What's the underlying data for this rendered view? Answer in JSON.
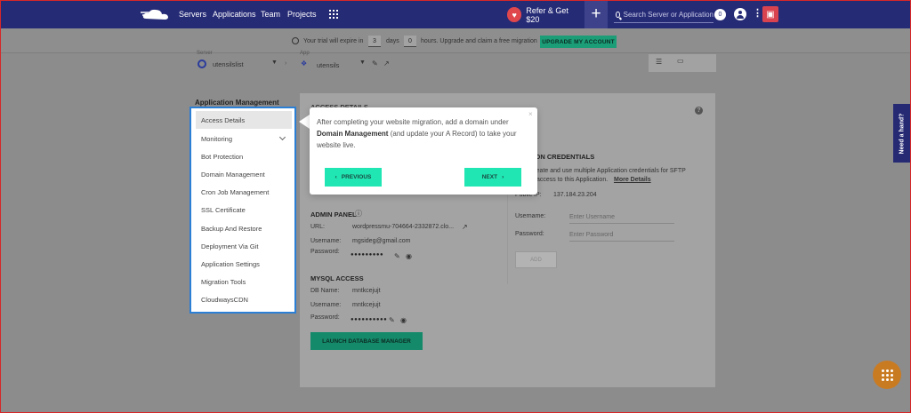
{
  "nav": {
    "links": [
      "Servers",
      "Applications",
      "Team",
      "Projects"
    ],
    "refer_label": "Refer & Get $20",
    "search_placeholder": "Search Server or Application",
    "notification_count": "0"
  },
  "trial": {
    "prefix": "Your trial will expire in",
    "days_value": "3",
    "days_label": "days",
    "hours_value": "0",
    "suffix": "hours. Upgrade and claim a free migration",
    "button": "UPGRADE MY ACCOUNT"
  },
  "context": {
    "server_label": "Server",
    "server_name": "utensilslist",
    "app_label": "App",
    "app_name": "utensils"
  },
  "sidebar": {
    "heading": "Application Management",
    "items": [
      {
        "label": "Access Details",
        "active": true
      },
      {
        "label": "Monitoring"
      },
      {
        "label": "Bot Protection"
      },
      {
        "label": "Domain Management"
      },
      {
        "label": "Cron Job Management"
      },
      {
        "label": "SSL Certificate"
      },
      {
        "label": "Backup And Restore"
      },
      {
        "label": "Deployment Via Git"
      },
      {
        "label": "Application Settings"
      },
      {
        "label": "Migration Tools"
      },
      {
        "label": "CloudwaysCDN"
      }
    ]
  },
  "card": {
    "title": "ACCESS DETAILS",
    "admin_panel": {
      "title": "ADMIN PANEL",
      "url_label": "URL:",
      "url_value": "wordpressmu-704664-2332872.clo...",
      "username_label": "Username:",
      "username_value": "mgsideg@gmail.com",
      "password_label": "Password:",
      "password_value": "●●●●●●●●●"
    },
    "mysql": {
      "title": "MYSQL ACCESS",
      "db_label": "DB Name:",
      "db_value": "mntkcejujt",
      "username_label": "Username:",
      "username_value": "mntkcejujt",
      "password_label": "Password:",
      "password_value": "●●●●●●●●●●",
      "launch_button": "LAUNCH DATABASE MANAGER"
    },
    "app_credentials": {
      "title": "ATION CREDENTIALS",
      "desc_line1": "n create and use multiple Application credentials for SFTP",
      "desc_line2": "access to this Application.",
      "more_link": "More Details",
      "public_ip_label": "Public IP:",
      "public_ip_value": "137.184.23.204",
      "username_label": "Username:",
      "username_placeholder": "Enter Username",
      "password_label": "Password:",
      "password_placeholder": "Enter Password",
      "add_button": "ADD"
    }
  },
  "tooltip": {
    "text_before": "After completing your website migration, add a domain under",
    "bold": "Domain Management",
    "text_after": "(and update your A Record) to take your website live.",
    "close": "×",
    "prev": "PREVIOUS",
    "next": "NEXT"
  },
  "help_tab": "Need a hand?"
}
